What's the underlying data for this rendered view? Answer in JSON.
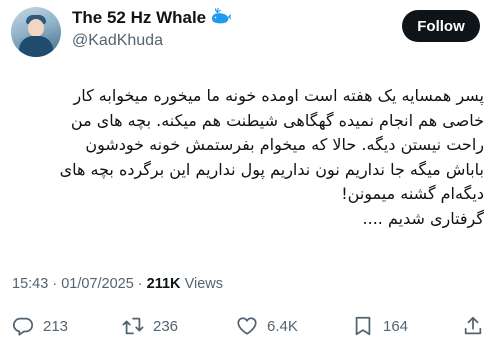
{
  "author": {
    "display_name": "The 52 Hz Whale",
    "handle": "@KadKhuda",
    "badge_icon": "whale-icon"
  },
  "follow_label": "Follow",
  "tweet": {
    "lines": [
      "پسر همسایه یک هفته است اومده خونه ما میخوره میخوابه کار",
      "خاصی هم انجام نمیده گهگاهی شیطنت هم میکنه. بچه های من",
      "راحت نیستن دیگه. حالا که میخوام بفرستمش خونه خودشون",
      "باباش میگه جا نداریم نون نداریم پول نداریم این برگرده بچه های",
      "دیگه‌ام گشنه میمونن!",
      "گرفتاری شدیم ...."
    ]
  },
  "meta": {
    "time": "15:43",
    "date": "01/07/2025",
    "views_count": "211K",
    "views_label": "Views"
  },
  "actions": {
    "replies": "213",
    "retweets": "236",
    "likes": "6.4K",
    "bookmarks": "164"
  },
  "colors": {
    "text": "#0f1419",
    "secondary": "#536471",
    "follow_bg": "#0f1419",
    "whale_blue": "#1d9bf0"
  }
}
